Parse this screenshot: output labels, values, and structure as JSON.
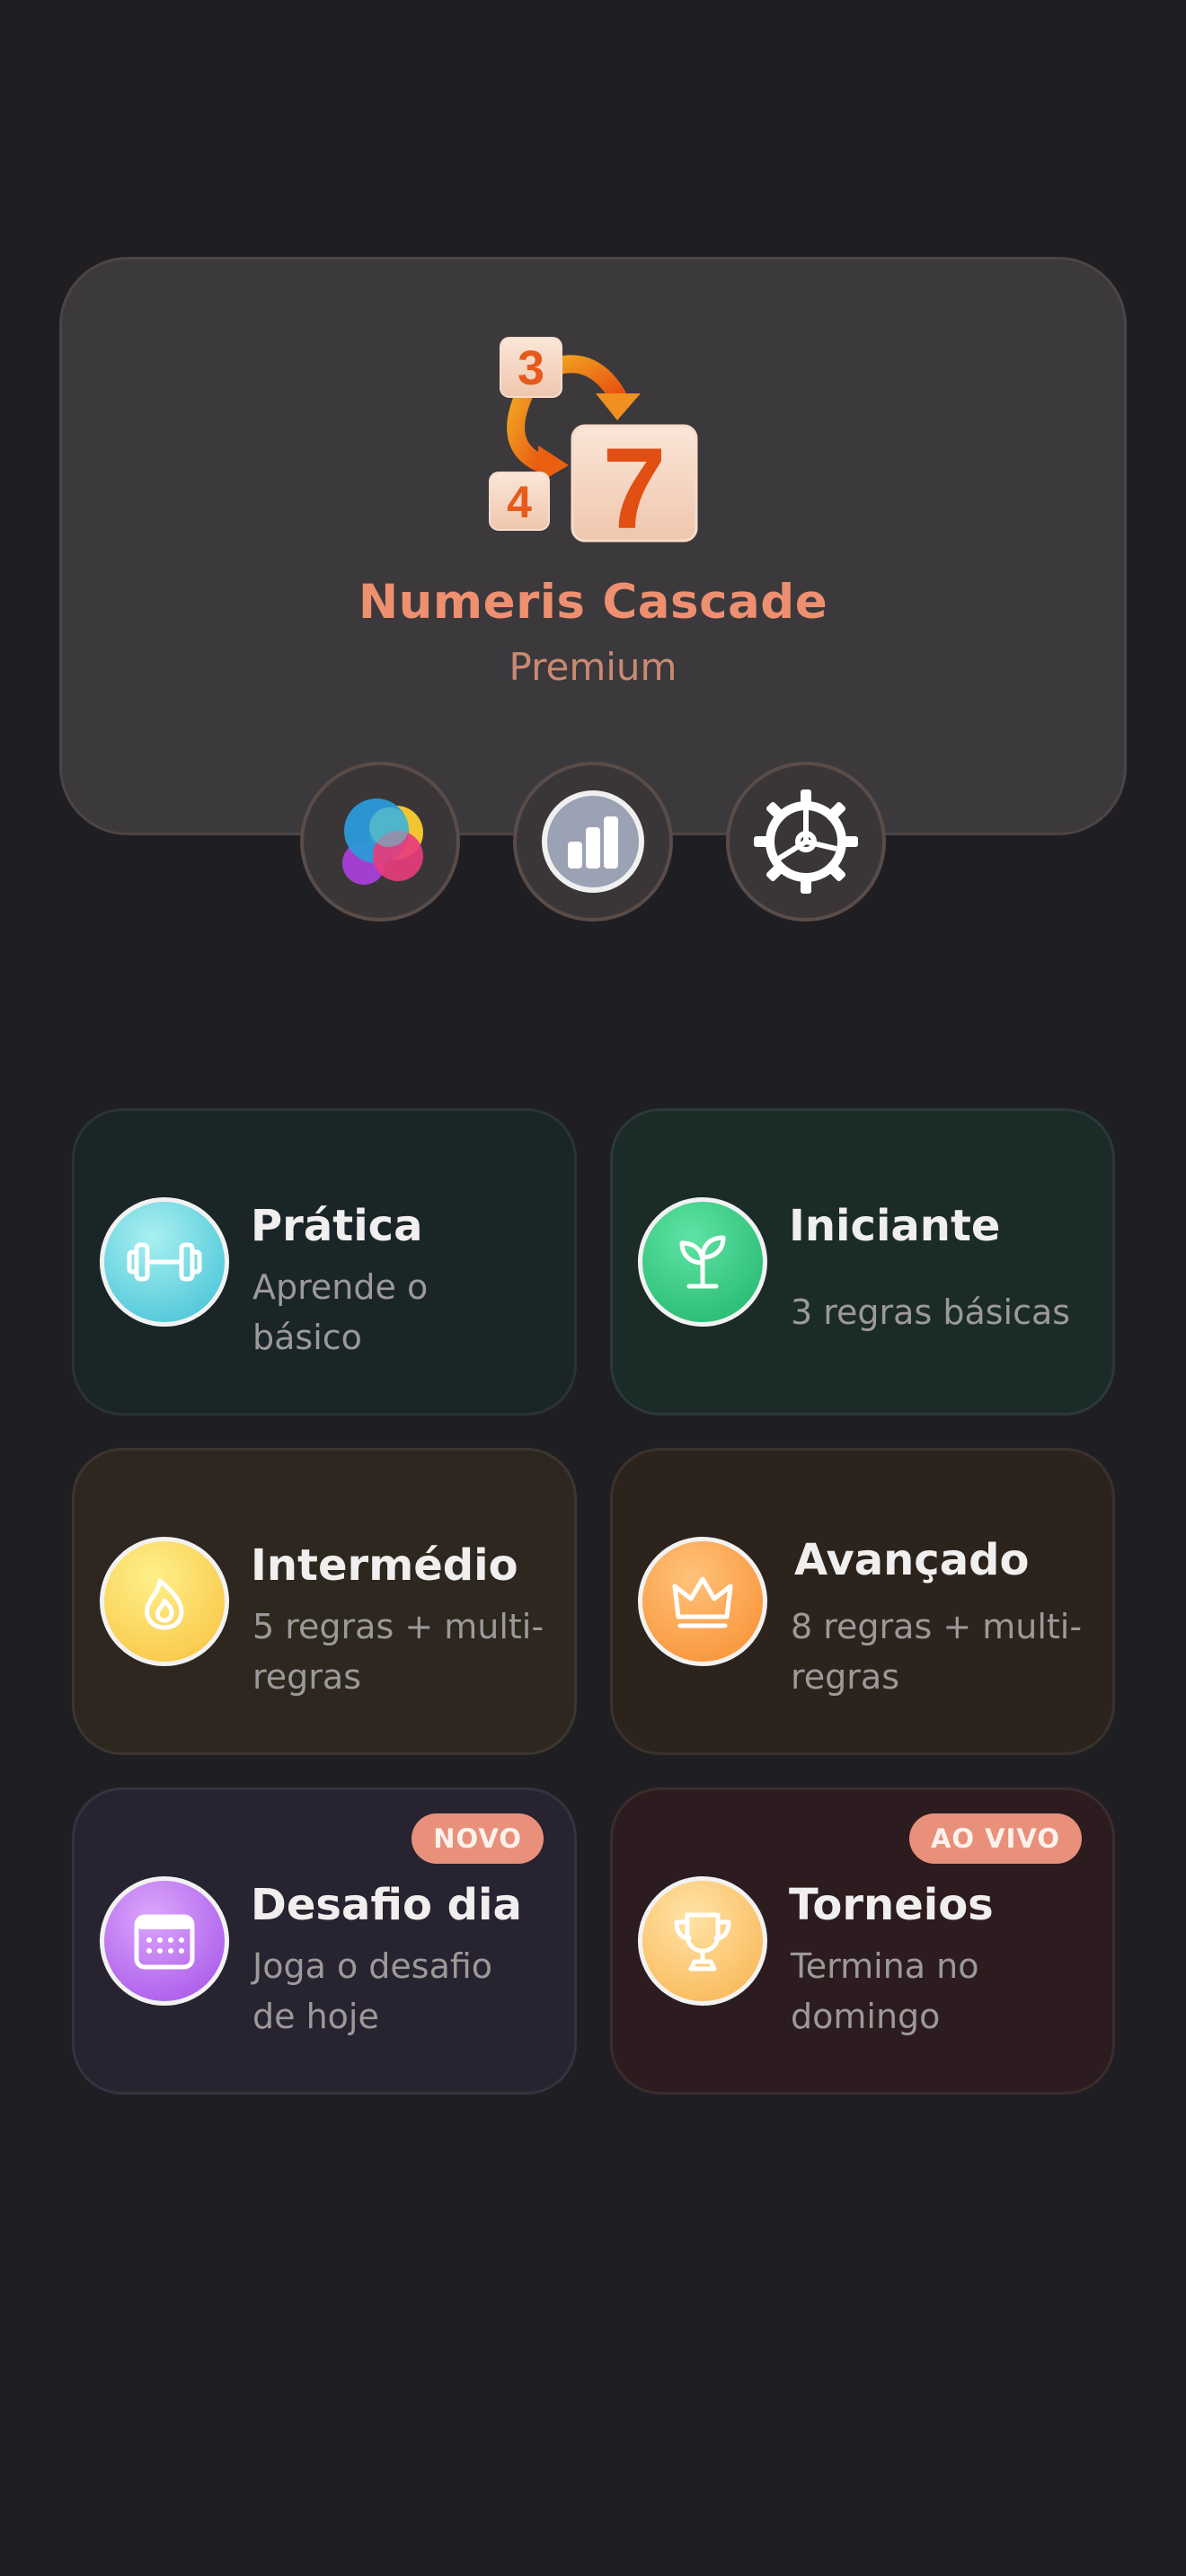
{
  "app": {
    "title": "Numeris Cascade",
    "subtitle": "Premium",
    "logo_tiles": [
      "3",
      "4",
      "7"
    ]
  },
  "top_buttons": [
    {
      "name": "game-center-button",
      "icon": "game-center-icon"
    },
    {
      "name": "stats-button",
      "icon": "bar-chart-icon"
    },
    {
      "name": "settings-button",
      "icon": "gear-icon"
    }
  ],
  "modes": [
    {
      "title": "Prática",
      "desc": "Aprende o básico",
      "icon": "dumbbell-icon",
      "bg": "#1a2528",
      "icon_bg": "#5fd0dc"
    },
    {
      "title": "Iniciante",
      "desc": "3 regras básicas",
      "icon": "sprout-icon",
      "bg": "#1b2b28",
      "icon_bg": "#2ecb7f"
    },
    {
      "title": "Intermédio",
      "desc": "5 regras + multi-regras",
      "icon": "flame-icon",
      "bg": "#2d2720",
      "icon_bg": "#fdd45c"
    },
    {
      "title": "Avançado",
      "desc": "8 regras + multi-regras",
      "icon": "crown-icon",
      "bg": "#2d231d",
      "icon_bg": "#fb9d4a"
    },
    {
      "title": "Desafio dia",
      "desc": "Joga o desafio de hoje",
      "icon": "calendar-icon",
      "bg": "#272331",
      "icon_bg": "#b56ff0",
      "badge": "NOVO"
    },
    {
      "title": "Torneios",
      "desc": "Termina no domingo",
      "icon": "trophy-icon",
      "bg": "#2d1c1f",
      "icon_bg": "#fbc86b",
      "badge": "AO VIVO"
    }
  ],
  "colors": {
    "background": "#1f1e23",
    "accent": "#ee9070",
    "badge": "#e8907a"
  }
}
